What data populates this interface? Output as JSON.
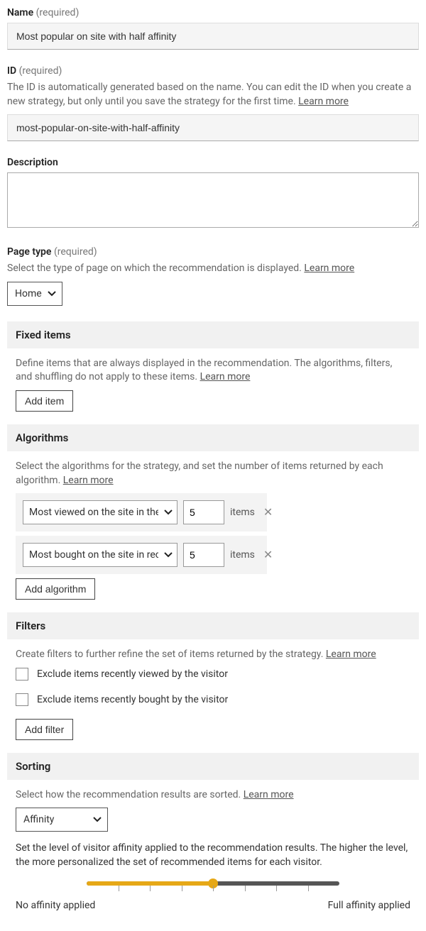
{
  "name": {
    "label": "Name",
    "required": "(required)",
    "value": "Most popular on site with half affinity"
  },
  "id": {
    "label": "ID",
    "required": "(required)",
    "helper": "The ID is automatically generated based on the name. You can edit the ID when you create a new strategy, but only until you save the strategy for the first time. ",
    "learn": "Learn more",
    "value": "most-popular-on-site-with-half-affinity"
  },
  "description": {
    "label": "Description",
    "value": ""
  },
  "pagetype": {
    "label": "Page type",
    "required": "(required)",
    "helper": "Select the type of page on which the recommendation is displayed. ",
    "learn": "Learn more",
    "value": "Home"
  },
  "fixed": {
    "title": "Fixed items",
    "helper": "Define items that are always displayed in the recommendation. The algorithms, filters, and shuffling do not apply to these items. ",
    "learn": "Learn more",
    "add": "Add item"
  },
  "algorithms": {
    "title": "Algorithms",
    "helper": "Select the algorithms for the strategy, and set the number of items returned by each algorithm. ",
    "learn": "Learn more",
    "rows": [
      {
        "name": "Most viewed on the site in the past",
        "count": "5",
        "suffix": "items"
      },
      {
        "name": "Most bought on the site in recent",
        "count": "5",
        "suffix": "items"
      }
    ],
    "add": "Add algorithm"
  },
  "filters": {
    "title": "Filters",
    "helper": "Create filters to further refine the set of items returned by the strategy. ",
    "learn": "Learn more",
    "checks": [
      "Exclude items recently viewed by the visitor",
      "Exclude items recently bought by the visitor"
    ],
    "add": "Add filter"
  },
  "sorting": {
    "title": "Sorting",
    "helper": "Select how the recommendation results are sorted. ",
    "learn": "Learn more",
    "value": "Affinity",
    "affinity_helper": "Set the level of visitor affinity applied to the recommendation results. The higher the level, the more personalized the set of recommended items for each visitor.",
    "min_label": "No affinity applied",
    "max_label": "Full affinity applied"
  }
}
